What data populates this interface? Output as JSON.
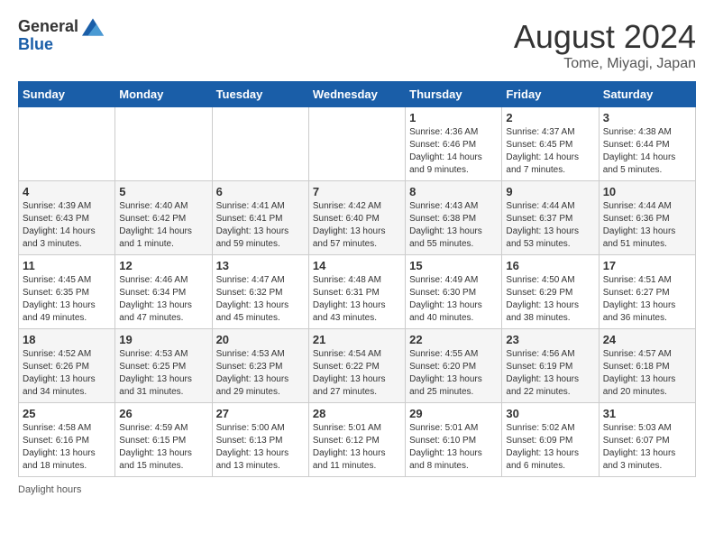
{
  "header": {
    "logo_general": "General",
    "logo_blue": "Blue",
    "month_title": "August 2024",
    "location": "Tome, Miyagi, Japan"
  },
  "days_of_week": [
    "Sunday",
    "Monday",
    "Tuesday",
    "Wednesday",
    "Thursday",
    "Friday",
    "Saturday"
  ],
  "weeks": [
    [
      {
        "day": "",
        "info": ""
      },
      {
        "day": "",
        "info": ""
      },
      {
        "day": "",
        "info": ""
      },
      {
        "day": "",
        "info": ""
      },
      {
        "day": "1",
        "info": "Sunrise: 4:36 AM\nSunset: 6:46 PM\nDaylight: 14 hours\nand 9 minutes."
      },
      {
        "day": "2",
        "info": "Sunrise: 4:37 AM\nSunset: 6:45 PM\nDaylight: 14 hours\nand 7 minutes."
      },
      {
        "day": "3",
        "info": "Sunrise: 4:38 AM\nSunset: 6:44 PM\nDaylight: 14 hours\nand 5 minutes."
      }
    ],
    [
      {
        "day": "4",
        "info": "Sunrise: 4:39 AM\nSunset: 6:43 PM\nDaylight: 14 hours\nand 3 minutes."
      },
      {
        "day": "5",
        "info": "Sunrise: 4:40 AM\nSunset: 6:42 PM\nDaylight: 14 hours\nand 1 minute."
      },
      {
        "day": "6",
        "info": "Sunrise: 4:41 AM\nSunset: 6:41 PM\nDaylight: 13 hours\nand 59 minutes."
      },
      {
        "day": "7",
        "info": "Sunrise: 4:42 AM\nSunset: 6:40 PM\nDaylight: 13 hours\nand 57 minutes."
      },
      {
        "day": "8",
        "info": "Sunrise: 4:43 AM\nSunset: 6:38 PM\nDaylight: 13 hours\nand 55 minutes."
      },
      {
        "day": "9",
        "info": "Sunrise: 4:44 AM\nSunset: 6:37 PM\nDaylight: 13 hours\nand 53 minutes."
      },
      {
        "day": "10",
        "info": "Sunrise: 4:44 AM\nSunset: 6:36 PM\nDaylight: 13 hours\nand 51 minutes."
      }
    ],
    [
      {
        "day": "11",
        "info": "Sunrise: 4:45 AM\nSunset: 6:35 PM\nDaylight: 13 hours\nand 49 minutes."
      },
      {
        "day": "12",
        "info": "Sunrise: 4:46 AM\nSunset: 6:34 PM\nDaylight: 13 hours\nand 47 minutes."
      },
      {
        "day": "13",
        "info": "Sunrise: 4:47 AM\nSunset: 6:32 PM\nDaylight: 13 hours\nand 45 minutes."
      },
      {
        "day": "14",
        "info": "Sunrise: 4:48 AM\nSunset: 6:31 PM\nDaylight: 13 hours\nand 43 minutes."
      },
      {
        "day": "15",
        "info": "Sunrise: 4:49 AM\nSunset: 6:30 PM\nDaylight: 13 hours\nand 40 minutes."
      },
      {
        "day": "16",
        "info": "Sunrise: 4:50 AM\nSunset: 6:29 PM\nDaylight: 13 hours\nand 38 minutes."
      },
      {
        "day": "17",
        "info": "Sunrise: 4:51 AM\nSunset: 6:27 PM\nDaylight: 13 hours\nand 36 minutes."
      }
    ],
    [
      {
        "day": "18",
        "info": "Sunrise: 4:52 AM\nSunset: 6:26 PM\nDaylight: 13 hours\nand 34 minutes."
      },
      {
        "day": "19",
        "info": "Sunrise: 4:53 AM\nSunset: 6:25 PM\nDaylight: 13 hours\nand 31 minutes."
      },
      {
        "day": "20",
        "info": "Sunrise: 4:53 AM\nSunset: 6:23 PM\nDaylight: 13 hours\nand 29 minutes."
      },
      {
        "day": "21",
        "info": "Sunrise: 4:54 AM\nSunset: 6:22 PM\nDaylight: 13 hours\nand 27 minutes."
      },
      {
        "day": "22",
        "info": "Sunrise: 4:55 AM\nSunset: 6:20 PM\nDaylight: 13 hours\nand 25 minutes."
      },
      {
        "day": "23",
        "info": "Sunrise: 4:56 AM\nSunset: 6:19 PM\nDaylight: 13 hours\nand 22 minutes."
      },
      {
        "day": "24",
        "info": "Sunrise: 4:57 AM\nSunset: 6:18 PM\nDaylight: 13 hours\nand 20 minutes."
      }
    ],
    [
      {
        "day": "25",
        "info": "Sunrise: 4:58 AM\nSunset: 6:16 PM\nDaylight: 13 hours\nand 18 minutes."
      },
      {
        "day": "26",
        "info": "Sunrise: 4:59 AM\nSunset: 6:15 PM\nDaylight: 13 hours\nand 15 minutes."
      },
      {
        "day": "27",
        "info": "Sunrise: 5:00 AM\nSunset: 6:13 PM\nDaylight: 13 hours\nand 13 minutes."
      },
      {
        "day": "28",
        "info": "Sunrise: 5:01 AM\nSunset: 6:12 PM\nDaylight: 13 hours\nand 11 minutes."
      },
      {
        "day": "29",
        "info": "Sunrise: 5:01 AM\nSunset: 6:10 PM\nDaylight: 13 hours\nand 8 minutes."
      },
      {
        "day": "30",
        "info": "Sunrise: 5:02 AM\nSunset: 6:09 PM\nDaylight: 13 hours\nand 6 minutes."
      },
      {
        "day": "31",
        "info": "Sunrise: 5:03 AM\nSunset: 6:07 PM\nDaylight: 13 hours\nand 3 minutes."
      }
    ]
  ],
  "footer": "Daylight hours"
}
